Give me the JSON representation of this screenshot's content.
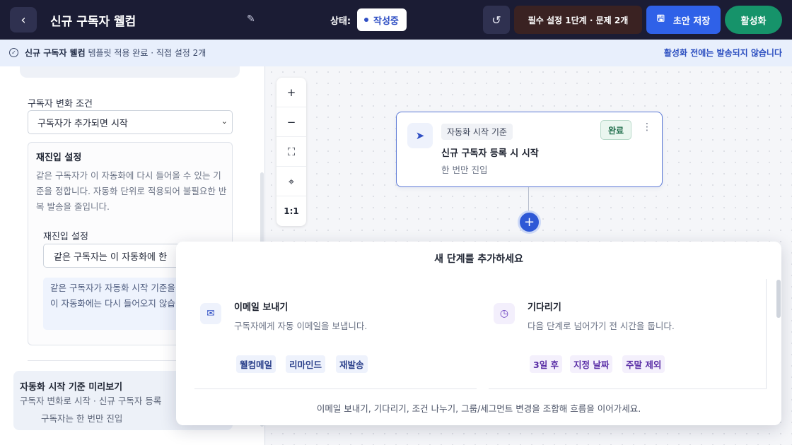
{
  "header": {
    "back_icon": "chevron-left-icon",
    "title": "신규 구독자 웰컴",
    "status_label": "상태:",
    "status_value": "작성중",
    "required_label": "필수 설정 1단계 · 문제 2개",
    "save_label": "초안 저장",
    "activate_label": "활성화"
  },
  "infobar": {
    "name": "신규 구독자 웰컴",
    "text": "템플릿 적용 완료 · 직접 설정 2개",
    "right_text": "활성화 전에는 발송되지 않습니다"
  },
  "panel": {
    "trigger_label": "구독자 변화 조건",
    "trigger_value": "구독자가 추가되면 시작",
    "reentry_title": "재진입 설정",
    "reentry_desc": "같은 구독자가 이 자동화에 다시 들어올 수 있는 기준을 정합니다. 자동화 단위로 적용되어 불필요한 반복 발송을 줄입니다.",
    "reentry_sublabel": "재진입 설정",
    "reentry_value": "같은 구독자는 이 자동화에 한",
    "reentry_note": "같은 구독자가 자동화 시작 기준을 만족해도 이 자동화에는 다시 들어오지 않습니다.",
    "preview_title": "자동화 시작 기준 미리보기",
    "preview_desc": "구독자 변화로 시작 · 신규 구독자 등록",
    "preview_sub": "구독자는 한 번만 진입"
  },
  "zoom": {
    "zoom_in": "+",
    "zoom_out": "−",
    "fit": "⛶",
    "center": "⌖",
    "reset": "1:1"
  },
  "node": {
    "type": "자동화 시작 기준",
    "title": "신규 구독자 등록 시 시작",
    "subtitle": "한 번만 진입",
    "badge": "완료",
    "menu": "⋮"
  },
  "popup": {
    "title": "새 단계를 추가하세요",
    "options": [
      {
        "icon": "mail-icon",
        "title": "이메일 보내기",
        "desc": "구독자에게 자동 이메일을 보냅니다.",
        "chips": [
          "웰컴메일",
          "리마인드",
          "재발송"
        ]
      },
      {
        "icon": "clock-icon",
        "title": "기다리기",
        "desc": "다음 단계로 넘어가기 전 시간을 둡니다.",
        "chips": [
          "3일 후",
          "지정 날짜",
          "주말 제외"
        ]
      }
    ],
    "footer": "이메일 보내기, 기다리기, 조건 나누기, 그룹/세그먼트 변경을 조합해 흐름을 이어가세요."
  },
  "colors": {
    "header_bg": "#1b1c34",
    "save": "#2f61e8",
    "activate": "#16936a",
    "accent": "#2e58d6"
  }
}
